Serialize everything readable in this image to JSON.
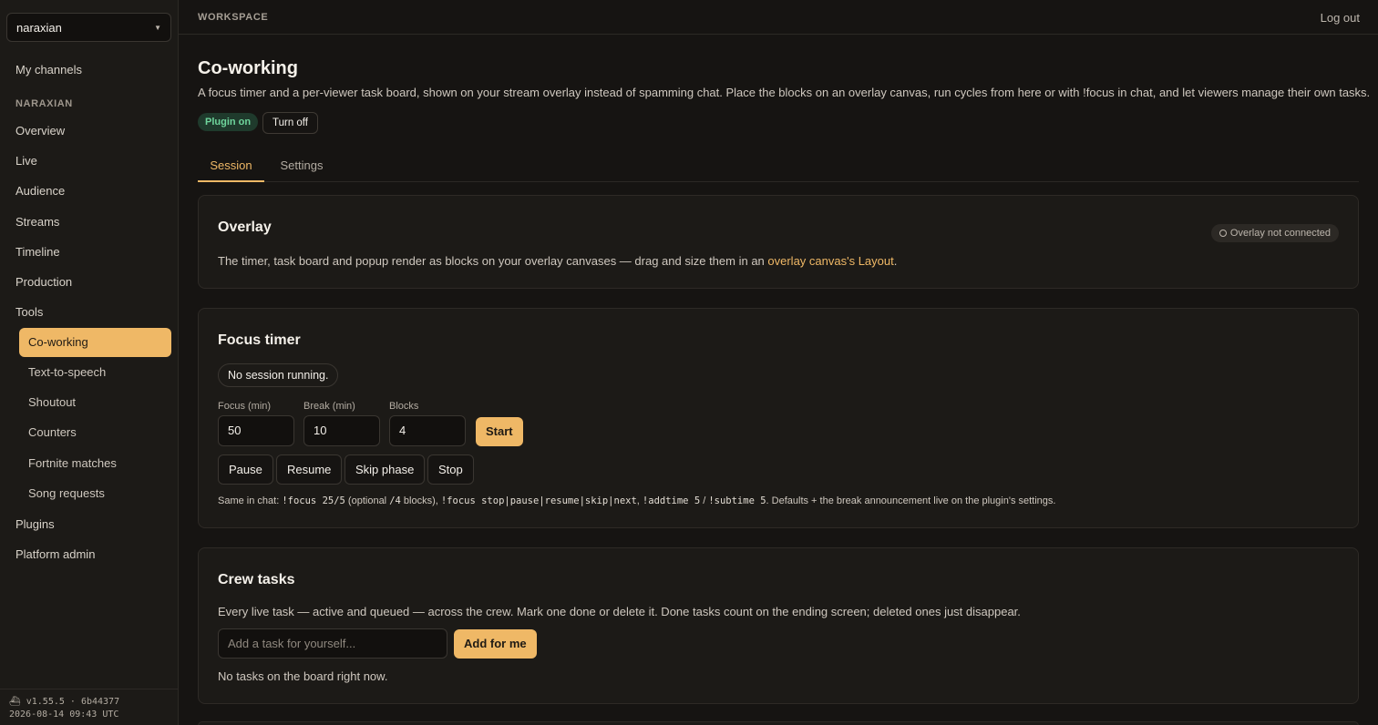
{
  "sidebar": {
    "workspace": "naraxian",
    "channels_link": "My channels",
    "section_title": "NARAXIAN",
    "items": [
      "Overview",
      "Live",
      "Audience",
      "Streams",
      "Timeline",
      "Production",
      "Tools"
    ],
    "tools_children": [
      "Co-working",
      "Text-to-speech",
      "Shoutout",
      "Counters",
      "Fortnite matches",
      "Song requests"
    ],
    "active_tool": "Co-working",
    "bottom_items": [
      "Plugins",
      "Platform admin"
    ],
    "footer_version": "v1.55.5 · 6b44377",
    "footer_date": "2026-08-14 09:43 UTC"
  },
  "topbar": {
    "crumb": "WORKSPACE",
    "logout": "Log out"
  },
  "page": {
    "title": "Co-working",
    "description": "A focus timer and a per-viewer task board, shown on your stream overlay instead of spamming chat. Place the blocks on an overlay canvas, run cycles from here or with !focus in chat, and let viewers manage their own tasks.",
    "plugin_status": "Plugin on",
    "turn_off": "Turn off",
    "tabs": [
      "Session",
      "Settings"
    ],
    "active_tab": "Session"
  },
  "overlay_card": {
    "title": "Overlay",
    "status": "Overlay not connected",
    "text_before": "The timer, task board and popup render as blocks on your overlay canvases — drag and size them in an ",
    "link": "overlay canvas's Layout",
    "text_after": "."
  },
  "focus_card": {
    "title": "Focus timer",
    "session_status": "No session running.",
    "fields": [
      {
        "label": "Focus (min)",
        "value": "50"
      },
      {
        "label": "Break (min)",
        "value": "10"
      },
      {
        "label": "Blocks",
        "value": "4"
      }
    ],
    "start": "Start",
    "controls": [
      "Pause",
      "Resume",
      "Skip phase",
      "Stop"
    ],
    "hint_prefix": "Same in chat: ",
    "hint_cmd1": "!focus 25/5",
    "hint_mid1": " (optional ",
    "hint_cmd2": "/4",
    "hint_mid2": " blocks), ",
    "hint_cmd3": "!focus stop|pause|resume|skip|next",
    "hint_mid3": ", ",
    "hint_cmd4": "!addtime 5",
    "hint_mid4": " / ",
    "hint_cmd5": "!subtime 5",
    "hint_suffix": ". Defaults + the break announcement live on the plugin's settings."
  },
  "tasks_card": {
    "title": "Crew tasks",
    "description": "Every live task — active and queued — across the crew. Mark one done or delete it. Done tasks count on the ending screen; deleted ones just disappear.",
    "input_placeholder": "Add a task for yourself...",
    "add_button": "Add for me",
    "empty": "No tasks on the board right now."
  },
  "colors": {
    "accent": "#efb866",
    "background": "#161412",
    "surface": "#1c1a17",
    "success": "#6fd59c"
  }
}
